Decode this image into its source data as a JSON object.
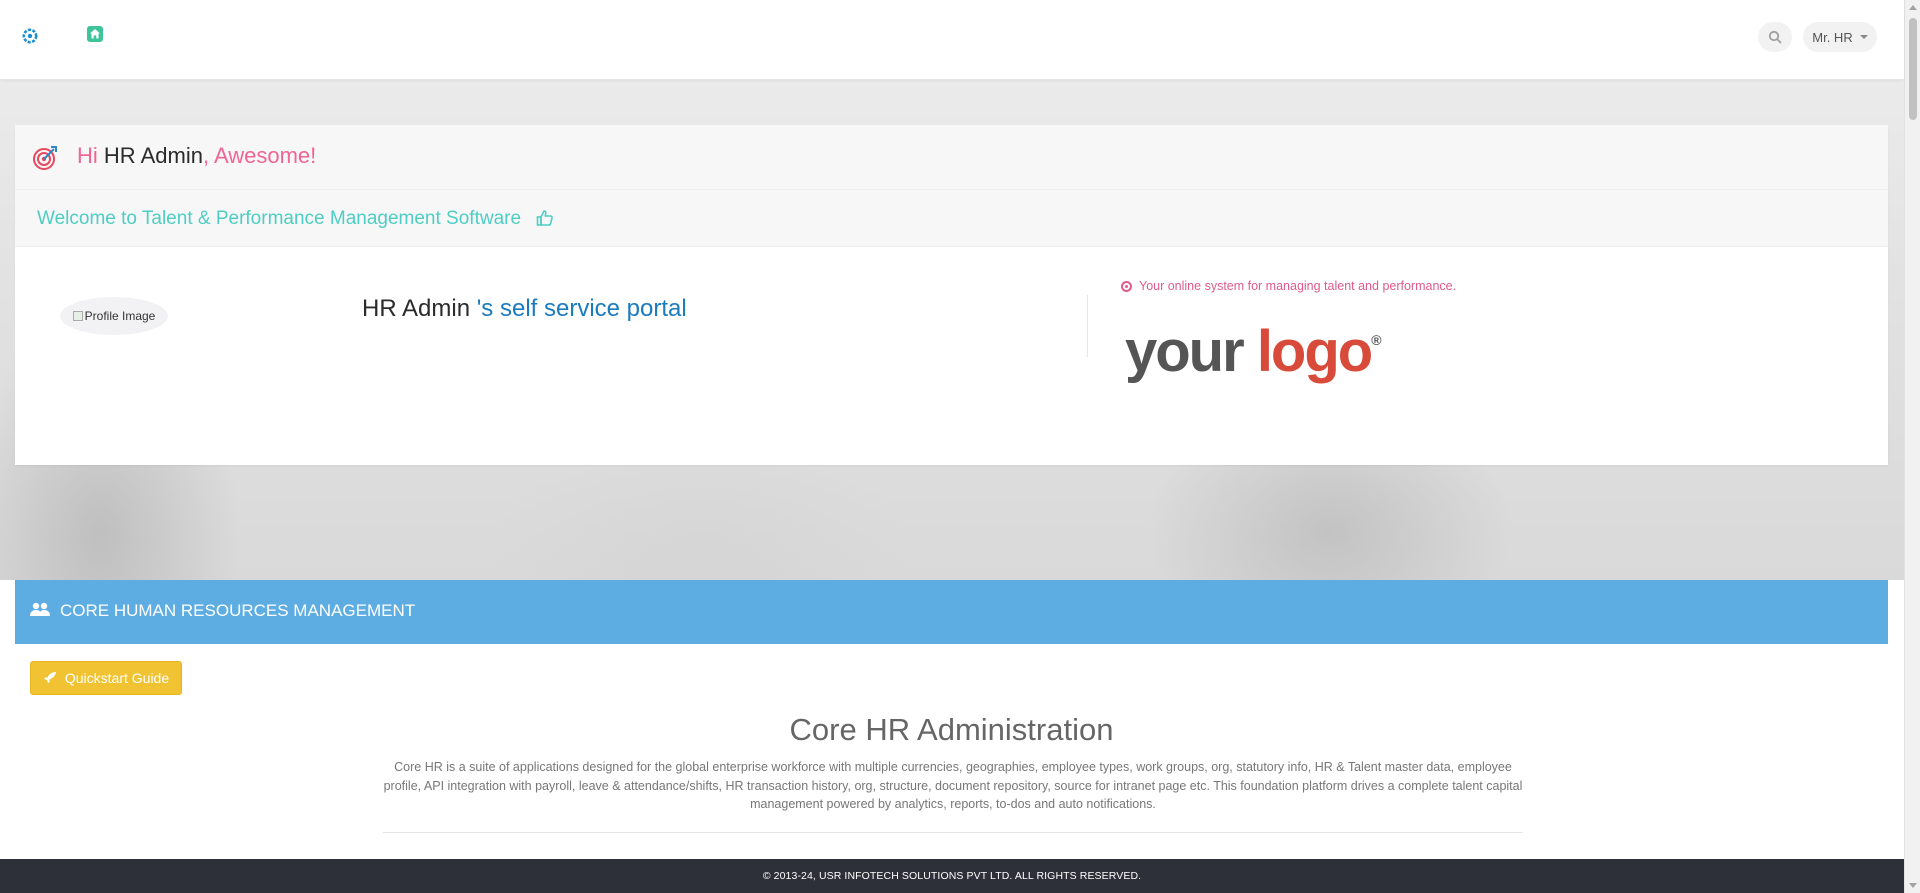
{
  "topbar": {
    "user_label": "Mr. HR"
  },
  "welcome": {
    "greet_hi": "Hi",
    "greet_name": "HR Admin",
    "greet_suffix": ", Awesome!",
    "welcome_text": "Welcome to Talent & Performance Management Software",
    "profile_alt": "Profile Image",
    "portal_name": "HR Admin",
    "portal_suffix": " 's self service portal",
    "tagline": "Your online system for managing talent and performance.",
    "logo_your": "your",
    "logo_logo": "logo",
    "logo_reg": "®"
  },
  "core": {
    "header": "CORE HUMAN RESOURCES MANAGEMENT",
    "quickstart": "Quickstart Guide",
    "title": "Core HR Administration",
    "description": "Core HR is a suite of applications designed for the global enterprise workforce with multiple currencies, geographies, employee types, work groups, org, statutory info, HR & Talent master data, employee profile, API integration with payroll, leave & attendance/shifts, HR transaction history, org, structure, document repository, source for intranet page etc. This foundation platform drives a complete talent capital management powered by analytics, reports, to-dos and auto notifications."
  },
  "footer": {
    "copyright": "© 2013-24, USR INFOTECH SOLUTIONS PVT LTD. ALL RIGHTS RESERVED."
  },
  "icons": {
    "brand": "settings-icon",
    "home": "home-icon",
    "search": "search-icon",
    "greet": "target-icon",
    "thumb": "thumbs-up-icon",
    "tagline": "dot-circle-icon",
    "section": "users-icon",
    "quickstart": "rocket-icon"
  },
  "colors": {
    "accent_pink": "#f06595",
    "accent_teal": "#4ecdc4",
    "accent_blue": "#1b7bbf",
    "section_header": "#5dade2",
    "quickstart_button": "#f1c232",
    "footer": "#2d3038"
  }
}
